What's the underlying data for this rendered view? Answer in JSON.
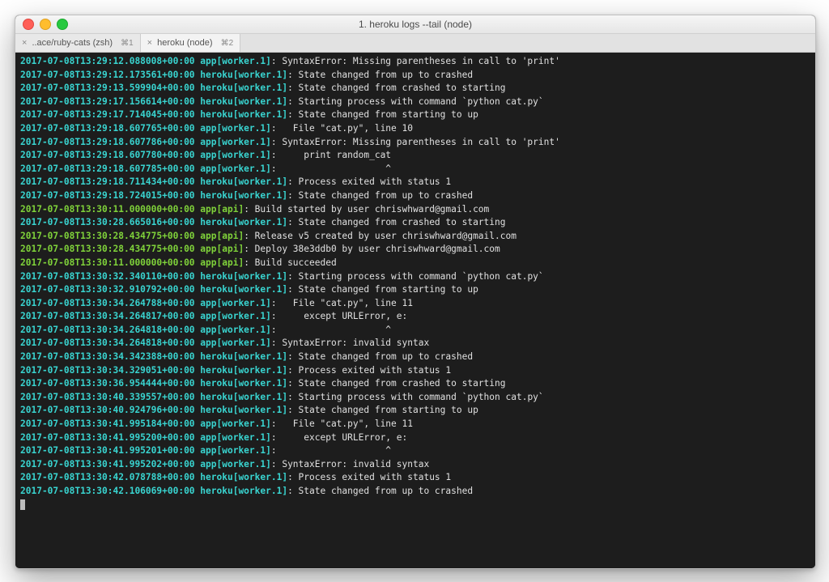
{
  "window": {
    "title": "1. heroku logs --tail (node)"
  },
  "tabs": [
    {
      "label": "..ace/ruby-cats (zsh)",
      "shortcut": "⌘1",
      "active": false
    },
    {
      "label": "heroku (node)",
      "shortcut": "⌘2",
      "active": true
    }
  ],
  "logs": [
    {
      "ts": "2017-07-08T13:29:12.088008+00:00",
      "src": "app[worker.1]",
      "kind": "app",
      "msg": "SyntaxError: Missing parentheses in call to 'print'"
    },
    {
      "ts": "2017-07-08T13:29:12.173561+00:00",
      "src": "heroku[worker.1]",
      "kind": "heroku",
      "msg": "State changed from up to crashed"
    },
    {
      "ts": "2017-07-08T13:29:13.599904+00:00",
      "src": "heroku[worker.1]",
      "kind": "heroku",
      "msg": "State changed from crashed to starting"
    },
    {
      "ts": "2017-07-08T13:29:17.156614+00:00",
      "src": "heroku[worker.1]",
      "kind": "heroku",
      "msg": "Starting process with command `python cat.py`"
    },
    {
      "ts": "2017-07-08T13:29:17.714045+00:00",
      "src": "heroku[worker.1]",
      "kind": "heroku",
      "msg": "State changed from starting to up"
    },
    {
      "ts": "2017-07-08T13:29:18.607765+00:00",
      "src": "app[worker.1]",
      "kind": "app",
      "msg": "  File \"cat.py\", line 10"
    },
    {
      "ts": "2017-07-08T13:29:18.607786+00:00",
      "src": "app[worker.1]",
      "kind": "app",
      "msg": "SyntaxError: Missing parentheses in call to 'print'"
    },
    {
      "ts": "2017-07-08T13:29:18.607780+00:00",
      "src": "app[worker.1]",
      "kind": "app",
      "msg": "    print random_cat"
    },
    {
      "ts": "2017-07-08T13:29:18.607785+00:00",
      "src": "app[worker.1]",
      "kind": "app",
      "msg": "                   ^"
    },
    {
      "ts": "2017-07-08T13:29:18.711434+00:00",
      "src": "heroku[worker.1]",
      "kind": "heroku",
      "msg": "Process exited with status 1"
    },
    {
      "ts": "2017-07-08T13:29:18.724015+00:00",
      "src": "heroku[worker.1]",
      "kind": "heroku",
      "msg": "State changed from up to crashed"
    },
    {
      "ts": "2017-07-08T13:30:11.000000+00:00",
      "src": "app[api]",
      "kind": "api",
      "msg": "Build started by user chriswhward@gmail.com"
    },
    {
      "ts": "2017-07-08T13:30:28.665016+00:00",
      "src": "heroku[worker.1]",
      "kind": "heroku",
      "msg": "State changed from crashed to starting"
    },
    {
      "ts": "2017-07-08T13:30:28.434775+00:00",
      "src": "app[api]",
      "kind": "api",
      "msg": "Release v5 created by user chriswhward@gmail.com"
    },
    {
      "ts": "2017-07-08T13:30:28.434775+00:00",
      "src": "app[api]",
      "kind": "api",
      "msg": "Deploy 38e3ddb0 by user chriswhward@gmail.com"
    },
    {
      "ts": "2017-07-08T13:30:11.000000+00:00",
      "src": "app[api]",
      "kind": "api",
      "msg": "Build succeeded"
    },
    {
      "ts": "2017-07-08T13:30:32.340110+00:00",
      "src": "heroku[worker.1]",
      "kind": "heroku",
      "msg": "Starting process with command `python cat.py`"
    },
    {
      "ts": "2017-07-08T13:30:32.910792+00:00",
      "src": "heroku[worker.1]",
      "kind": "heroku",
      "msg": "State changed from starting to up"
    },
    {
      "ts": "2017-07-08T13:30:34.264788+00:00",
      "src": "app[worker.1]",
      "kind": "app",
      "msg": "  File \"cat.py\", line 11"
    },
    {
      "ts": "2017-07-08T13:30:34.264817+00:00",
      "src": "app[worker.1]",
      "kind": "app",
      "msg": "    except URLError, e:"
    },
    {
      "ts": "2017-07-08T13:30:34.264818+00:00",
      "src": "app[worker.1]",
      "kind": "app",
      "msg": "                   ^"
    },
    {
      "ts": "2017-07-08T13:30:34.264818+00:00",
      "src": "app[worker.1]",
      "kind": "app",
      "msg": "SyntaxError: invalid syntax"
    },
    {
      "ts": "2017-07-08T13:30:34.342388+00:00",
      "src": "heroku[worker.1]",
      "kind": "heroku",
      "msg": "State changed from up to crashed"
    },
    {
      "ts": "2017-07-08T13:30:34.329051+00:00",
      "src": "heroku[worker.1]",
      "kind": "heroku",
      "msg": "Process exited with status 1"
    },
    {
      "ts": "2017-07-08T13:30:36.954444+00:00",
      "src": "heroku[worker.1]",
      "kind": "heroku",
      "msg": "State changed from crashed to starting"
    },
    {
      "ts": "2017-07-08T13:30:40.339557+00:00",
      "src": "heroku[worker.1]",
      "kind": "heroku",
      "msg": "Starting process with command `python cat.py`"
    },
    {
      "ts": "2017-07-08T13:30:40.924796+00:00",
      "src": "heroku[worker.1]",
      "kind": "heroku",
      "msg": "State changed from starting to up"
    },
    {
      "ts": "2017-07-08T13:30:41.995184+00:00",
      "src": "app[worker.1]",
      "kind": "app",
      "msg": "  File \"cat.py\", line 11"
    },
    {
      "ts": "2017-07-08T13:30:41.995200+00:00",
      "src": "app[worker.1]",
      "kind": "app",
      "msg": "    except URLError, e:"
    },
    {
      "ts": "2017-07-08T13:30:41.995201+00:00",
      "src": "app[worker.1]",
      "kind": "app",
      "msg": "                   ^"
    },
    {
      "ts": "2017-07-08T13:30:41.995202+00:00",
      "src": "app[worker.1]",
      "kind": "app",
      "msg": "SyntaxError: invalid syntax"
    },
    {
      "ts": "2017-07-08T13:30:42.078788+00:00",
      "src": "heroku[worker.1]",
      "kind": "heroku",
      "msg": "Process exited with status 1"
    },
    {
      "ts": "2017-07-08T13:30:42.106069+00:00",
      "src": "heroku[worker.1]",
      "kind": "heroku",
      "msg": "State changed from up to crashed"
    }
  ]
}
